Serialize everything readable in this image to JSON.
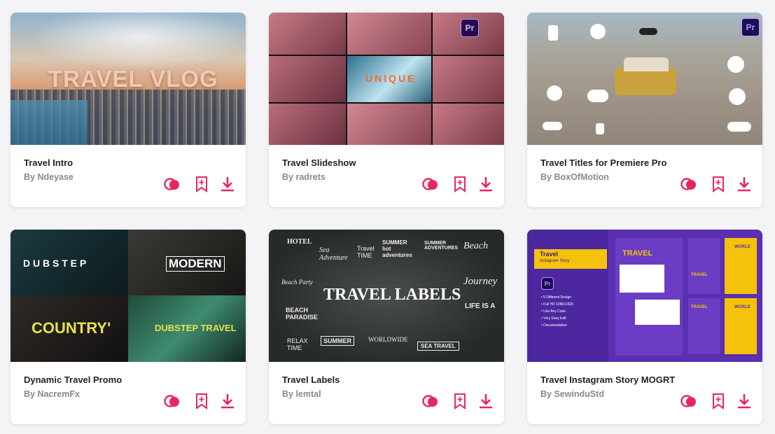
{
  "cards": [
    {
      "title": "Travel Intro",
      "author": "By Ndeyase",
      "thumb_text": "TRAVEL VLOG"
    },
    {
      "title": "Travel Slideshow",
      "author": "By radrets",
      "thumb_text": "UNIQUE",
      "badge": "Pr"
    },
    {
      "title": "Travel Titles for Premiere Pro",
      "author": "By BoxOfMotion",
      "badge": "Pr"
    },
    {
      "title": "Dynamic Travel Promo",
      "author": "By NacremFx",
      "thumb_texts": [
        "D U B S T E P",
        "MODERN",
        "COUNTRY'",
        "DUBSTEP TRAVEL"
      ]
    },
    {
      "title": "Travel Labels",
      "author": "By lemtal",
      "thumb_text": "TRAVEL LABELS",
      "labels": [
        "HOTEL",
        "Sea Adventure",
        "Travel TIME",
        "SUMMER hot adventures",
        "SUMMER ADVENTURES",
        "Beach",
        "Beach Party",
        "BEACH PARADISE",
        "Journey",
        "LIFE IS A",
        "RELAX TIME",
        "SUMMER",
        "WORLDWIDE",
        "SEA TRAVEL"
      ]
    },
    {
      "title": "Travel Instagram Story MOGRT",
      "author": "By SewinduStd",
      "badge": "Pr",
      "thumb_texts": [
        "Travel",
        "Instagram Story",
        "TRAVEL",
        "TRAVEL",
        "WORLD",
        "TRAVEL",
        "WORLD"
      ],
      "features": [
        "• 5 Different Design",
        "• Full HD 1080x1920",
        "• Use Any Color",
        "• Very Easy Edit",
        "• Documentation"
      ]
    }
  ],
  "icons": {
    "preview": "preview-circles-icon",
    "bookmark": "bookmark-add-icon",
    "download": "download-icon"
  },
  "colors": {
    "accent": "#e8265e",
    "background": "#f4f4f6"
  }
}
